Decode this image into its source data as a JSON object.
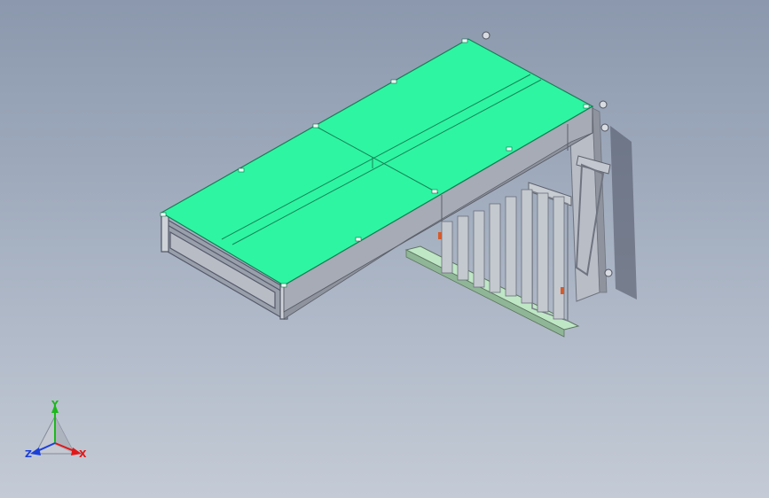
{
  "window": {
    "kind": "cad-viewport"
  },
  "model": {
    "colors": {
      "top_panel": "#2ef5a2",
      "top_panel_edge": "#1bb877",
      "frame": "#a9adb6",
      "frame_dark": "#6f7480",
      "frame_light": "#cfd2d8",
      "rail": "#aeb7a9",
      "shadow": "#4b5160"
    }
  },
  "triad": {
    "y_label": "Y",
    "x_label": "X",
    "z_label": "Z",
    "colors": {
      "x": "#e01818",
      "y": "#1cb81c",
      "z": "#1c3fd8"
    }
  }
}
